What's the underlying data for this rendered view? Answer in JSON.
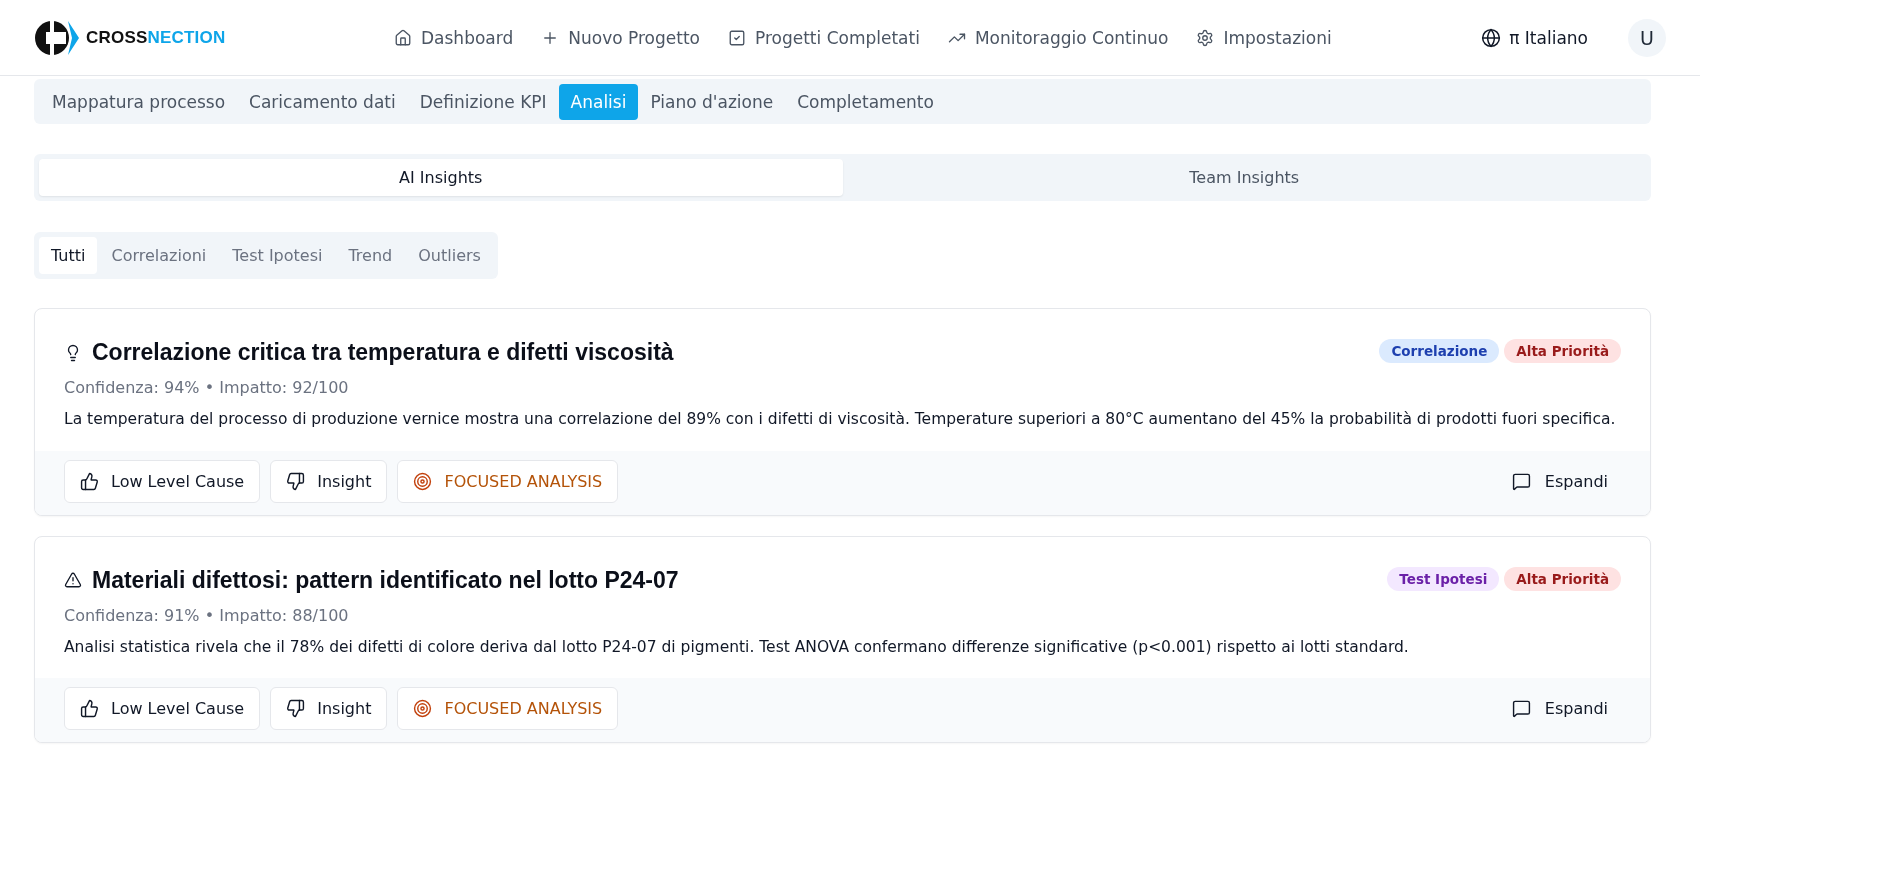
{
  "brand": {
    "prefix": "CROSS",
    "suffix": "NECTION"
  },
  "nav": [
    {
      "label": "Dashboard",
      "kind": "home"
    },
    {
      "label": "Nuovo Progetto",
      "kind": "plus"
    },
    {
      "label": "Progetti Completati",
      "kind": "check"
    },
    {
      "label": "Monitoraggio Continuo",
      "kind": "trend"
    },
    {
      "label": "Impostazioni",
      "kind": "gear"
    }
  ],
  "language": "π Italiano",
  "avatar": "U",
  "steps": [
    {
      "label": "Mappatura processo",
      "selected": false
    },
    {
      "label": "Caricamento dati",
      "selected": false
    },
    {
      "label": "Definizione KPI",
      "selected": false
    },
    {
      "label": "Analisi",
      "selected": true
    },
    {
      "label": "Piano d'azione",
      "selected": false
    },
    {
      "label": "Completamento",
      "selected": false
    }
  ],
  "views": [
    {
      "label": "AI Insights",
      "selected": true
    },
    {
      "label": "Team Insights",
      "selected": false
    }
  ],
  "filters": [
    {
      "label": "Tutti",
      "selected": true
    },
    {
      "label": "Correlazioni",
      "selected": false
    },
    {
      "label": "Test Ipotesi",
      "selected": false
    },
    {
      "label": "Trend",
      "selected": false
    },
    {
      "label": "Outliers",
      "selected": false
    }
  ],
  "insights": [
    {
      "kind": "idea",
      "title": "Correlazione critica tra temperatura e difetti viscosità",
      "badges": [
        {
          "label": "Correlazione",
          "kind": "category",
          "color": "#dbeafe"
        },
        {
          "label": "Alta Priorità",
          "kind": "priority",
          "color": "#fee2e2"
        }
      ],
      "meta": "Confidenza: 94% • Impatto: 92/100",
      "description": "La temperatura del processo di produzione vernice mostra una correlazione del 89% con i difetti di viscosità. Temperature superiori a 80°C aumentano del 45% la probabilità di prodotti fuori specifica.",
      "actions": [
        {
          "label": "Low Level Cause",
          "kind": "up"
        },
        {
          "label": "Insight",
          "kind": "down"
        },
        {
          "label": "FOCUSED ANALYSIS",
          "kind": "target"
        }
      ],
      "expand": "Espandi"
    },
    {
      "kind": "warning",
      "title": "Materiali difettosi: pattern identificato nel lotto P24-07",
      "badges": [
        {
          "label": "Test Ipotesi",
          "kind": "hypothesis",
          "color": "#f3e8ff"
        },
        {
          "label": "Alta Priorità",
          "kind": "priority",
          "color": "#fee2e2"
        }
      ],
      "meta": "Confidenza: 91% • Impatto: 88/100",
      "description": "Analisi statistica rivela che il 78% dei difetti di colore deriva dal lotto P24-07 di pigmenti. Test ANOVA confermano differenze significative (p<0.001) rispetto ai lotti standard.",
      "actions": [
        {
          "label": "Low Level Cause",
          "kind": "up"
        },
        {
          "label": "Insight",
          "kind": "down"
        },
        {
          "label": "FOCUSED ANALYSIS",
          "kind": "target"
        }
      ],
      "expand": "Espandi"
    }
  ]
}
